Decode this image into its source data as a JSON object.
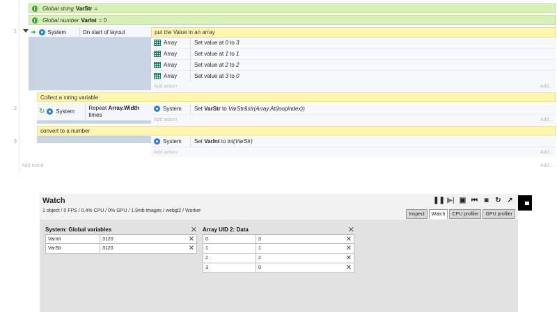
{
  "globals": [
    {
      "prefix": "Global string",
      "name": "VarStr",
      "value": "="
    },
    {
      "prefix": "Global number",
      "name": "VarInt",
      "value": "= 0"
    }
  ],
  "events": [
    {
      "number": "1",
      "condition": {
        "object": "System",
        "text": "On start of layout"
      },
      "comment": "put the Value in an array",
      "actions": [
        {
          "object": "Array",
          "text_pre": "Set value at ",
          "text_it": "0",
          "text_mid": " to ",
          "text_it2": "3"
        },
        {
          "object": "Array",
          "text_pre": "Set value at ",
          "text_it": "1",
          "text_mid": " to ",
          "text_it2": "1"
        },
        {
          "object": "Array",
          "text_pre": "Set value at ",
          "text_it": "2",
          "text_mid": " to ",
          "text_it2": "2"
        },
        {
          "object": "Array",
          "text_pre": "Set value at ",
          "text_it": "3",
          "text_mid": " to ",
          "text_it2": "0"
        }
      ]
    },
    {
      "number": "2",
      "comment": "Collect a string variable",
      "condition": {
        "object": "System",
        "text_pre": "Repeat ",
        "text_bold": "Array.Width",
        "text_post": "times"
      },
      "actions": [
        {
          "object": "System",
          "text_pre": "Set ",
          "text_bold": "VarStr",
          "text_mid": " to ",
          "text_it": "VarStr&str(Array.At(loopindex))"
        }
      ]
    },
    {
      "number": "3",
      "comment": "convert to a number",
      "actions": [
        {
          "object": "System",
          "text_pre": "Set ",
          "text_bold": "VarInt",
          "text_mid": " to ",
          "text_it": "int(VarStr)"
        }
      ]
    }
  ],
  "add_action": "Add action",
  "add_right": "Add...",
  "add_event": "Add event",
  "watch": {
    "title": "Watch",
    "stats": "1 object / 0 FPS / 0.4% CPU / 0% GPU / 1.9mb images / webgl2 / Worker",
    "tabs": [
      "Inspect",
      "Watch",
      "CPU profiler",
      "GPU profiler"
    ],
    "active_tab": "Watch",
    "tables": [
      {
        "title": "System: Global variables",
        "rows": [
          [
            "VarInt",
            "3120"
          ],
          [
            "VarStr",
            "3120"
          ]
        ]
      },
      {
        "title": "Array UID 2: Data",
        "rows": [
          [
            "0",
            "3"
          ],
          [
            "1",
            "1"
          ],
          [
            "2",
            "2"
          ],
          [
            "3",
            "0"
          ]
        ]
      }
    ],
    "toolbar_icons": [
      "pause-icon",
      "step-icon",
      "save-icon",
      "restart-icon",
      "camera-icon",
      "reload-icon",
      "popout-icon"
    ]
  }
}
